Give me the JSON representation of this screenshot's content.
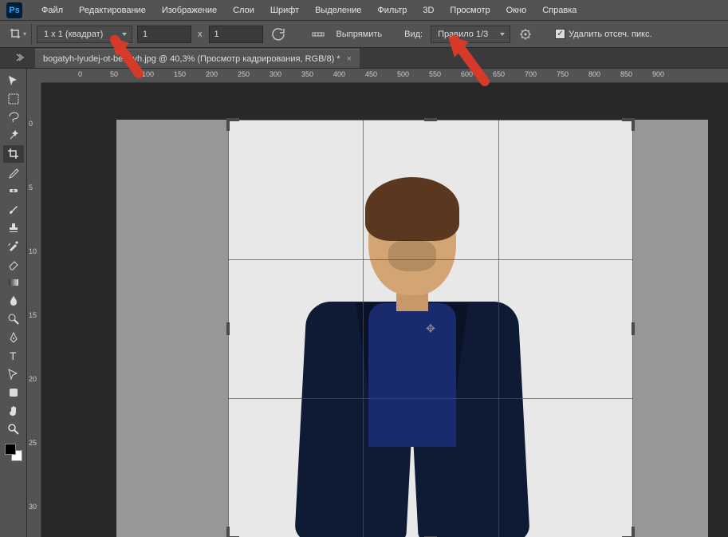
{
  "app_logo": "Ps",
  "menu": {
    "file": "Файл",
    "edit": "Редактирование",
    "image": "Изображение",
    "layers": "Слои",
    "type": "Шрифт",
    "select": "Выделение",
    "filter": "Фильтр",
    "threeD": "3D",
    "view": "Просмотр",
    "window": "Окно",
    "help": "Справка"
  },
  "options": {
    "aspect": "1 x 1 (квадрат)",
    "width": "1",
    "x_label": "x",
    "height": "1",
    "straighten": "Выпрямить",
    "view_label": "Вид:",
    "overlay": "Правило 1/3",
    "delete_cropped": "Удалить отсеч. пикс."
  },
  "tab": {
    "title": "bogatyh-lyudej-ot-bednyh.jpg @ 40,3% (Просмотр кадрирования, RGB/8) *",
    "close": "×"
  },
  "ruler_h": [
    "0",
    "50",
    "100",
    "150",
    "200",
    "250",
    "300",
    "350",
    "400",
    "450",
    "500",
    "550",
    "600",
    "650",
    "700",
    "750",
    "800",
    "850",
    "900"
  ],
  "ruler_v": [
    "0",
    "5",
    "10",
    "15",
    "20",
    "25",
    "30"
  ],
  "tools": {
    "move": "move",
    "marquee": "marquee",
    "lasso": "lasso",
    "wand": "wand",
    "crop": "crop",
    "eyedrop": "eyedrop",
    "heal": "heal",
    "brush": "brush",
    "stamp": "stamp",
    "history": "history",
    "eraser": "eraser",
    "gradient": "gradient",
    "blur": "blur",
    "dodge": "dodge",
    "pen": "pen",
    "text": "text",
    "path": "path",
    "shape": "shape",
    "hand": "hand",
    "zoom": "zoom"
  },
  "colors": {
    "accent_red": "#d83a2a"
  }
}
